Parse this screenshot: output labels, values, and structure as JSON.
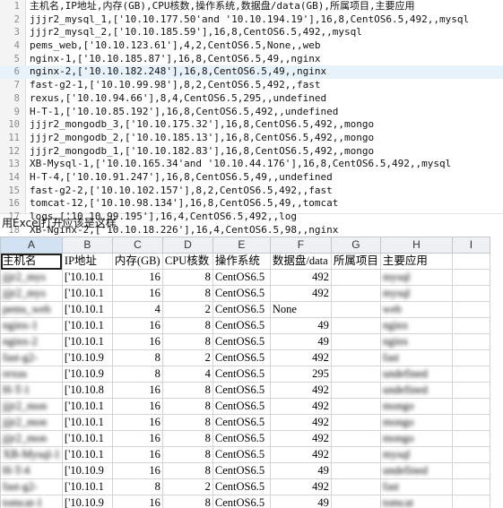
{
  "editor": {
    "lines": [
      {
        "n": "1",
        "text": "主机名,IP地址,内存(GB),CPU核数,操作系统,数据盘/data(GB),所属项目,主要应用"
      },
      {
        "n": "2",
        "text": "jjjr2_mysql_1,['10.10.177.50'and '10.10.194.19'],16,8,CentOS6.5,492,,mysql"
      },
      {
        "n": "3",
        "text": "jjjr2_mysql_2,['10.10.185.59'],16,8,CentOS6.5,492,,mysql"
      },
      {
        "n": "4",
        "text": "pems_web,['10.10.123.61'],4,2,CentOS6.5,None,,web"
      },
      {
        "n": "5",
        "text": "nginx-1,['10.10.185.87'],16,8,CentOS6.5,49,,nginx"
      },
      {
        "n": "6",
        "text": "nginx-2,['10.10.182.248'],16,8,CentOS6.5,49,,nginx"
      },
      {
        "n": "7",
        "text": "fast-g2-1,['10.10.99.98'],8,2,CentOS6.5,492,,fast"
      },
      {
        "n": "8",
        "text": "rexus,['10.10.94.66'],8,4,CentOS6.5,295,,undefined"
      },
      {
        "n": "9",
        "text": "H-T-1,['10.10.85.192'],16,8,CentOS6.5,492,,undefined"
      },
      {
        "n": "10",
        "text": "jjjr2_mongodb_3,['10.10.175.32'],16,8,CentOS6.5,492,,mongo"
      },
      {
        "n": "11",
        "text": "jjjr2_mongodb_2,['10.10.185.13'],16,8,CentOS6.5,492,,mongo"
      },
      {
        "n": "12",
        "text": "jjjr2_mongodb_1,['10.10.182.83'],16,8,CentOS6.5,492,,mongo"
      },
      {
        "n": "13",
        "text": "XB-Mysql-1,['10.10.165.34'and '10.10.44.176'],16,8,CentOS6.5,492,,mysql"
      },
      {
        "n": "14",
        "text": "H-T-4,['10.10.91.247'],16,8,CentOS6.5,49,,undefined"
      },
      {
        "n": "15",
        "text": "fast-g2-2,['10.10.102.157'],8,2,CentOS6.5,492,,fast"
      },
      {
        "n": "16",
        "text": "tomcat-12,['10.10.98.134'],16,8,CentOS6.5,49,,tomcat"
      },
      {
        "n": "17",
        "text": "logs,['10.10.99.195'],16,4,CentOS6.5,492,,log"
      },
      {
        "n": "18",
        "text": "XB-Nginx-2,['10.10.18.226'],16,4,CentOS6.5,98,,nginx"
      }
    ]
  },
  "caption": "用Excel打开应该是这样",
  "sheet": {
    "columns": [
      "A",
      "B",
      "C",
      "D",
      "E",
      "F",
      "G",
      "H",
      "I"
    ],
    "header_row": [
      "主机名",
      "IP地址",
      "内存(GB)",
      "CPU核数",
      "操作系统",
      "数据盘/data",
      "所属项目",
      "主要应用",
      ""
    ],
    "rows": [
      [
        "jjjr2_mys",
        "['10.10.1",
        "16",
        "8",
        "CentOS6.5",
        "492",
        "",
        "mysql",
        ""
      ],
      [
        "jjjr2_mys",
        "['10.10.1",
        "16",
        "8",
        "CentOS6.5",
        "492",
        "",
        "mysql",
        ""
      ],
      [
        "pems_web",
        "['10.10.1",
        "4",
        "2",
        "CentOS6.5",
        "None",
        "",
        "web",
        ""
      ],
      [
        "nginx-1",
        "['10.10.1",
        "16",
        "8",
        "CentOS6.5",
        "49",
        "",
        "nginx",
        ""
      ],
      [
        "nginx-2",
        "['10.10.1",
        "16",
        "8",
        "CentOS6.5",
        "49",
        "",
        "nginx",
        ""
      ],
      [
        "fast-g2-",
        "['10.10.9",
        "8",
        "2",
        "CentOS6.5",
        "492",
        "",
        "fast",
        ""
      ],
      [
        "rexus",
        "['10.10.9",
        "8",
        "4",
        "CentOS6.5",
        "295",
        "",
        "undefined",
        ""
      ],
      [
        "H-T-1",
        "['10.10.8",
        "16",
        "8",
        "CentOS6.5",
        "492",
        "",
        "undefined",
        ""
      ],
      [
        "jjjr2_mon",
        "['10.10.1",
        "16",
        "8",
        "CentOS6.5",
        "492",
        "",
        "mongo",
        ""
      ],
      [
        "jjjr2_mon",
        "['10.10.1",
        "16",
        "8",
        "CentOS6.5",
        "492",
        "",
        "mongo",
        ""
      ],
      [
        "jjjr2_mon",
        "['10.10.1",
        "16",
        "8",
        "CentOS6.5",
        "492",
        "",
        "mongo",
        ""
      ],
      [
        "XB-Mysql-1",
        "['10.10.1",
        "16",
        "8",
        "CentOS6.5",
        "492",
        "",
        "mysql",
        ""
      ],
      [
        "H-T-4",
        "['10.10.9",
        "16",
        "8",
        "CentOS6.5",
        "49",
        "",
        "undefined",
        ""
      ],
      [
        "fast-g2-",
        "['10.10.1",
        "8",
        "2",
        "CentOS6.5",
        "492",
        "",
        "fast",
        ""
      ],
      [
        "tomcat-1",
        "['10.10.9",
        "16",
        "8",
        "CentOS6.5",
        "49",
        "",
        "tomcat",
        ""
      ]
    ],
    "numeric_cols": [
      2,
      3,
      5
    ],
    "blur_cols": [
      0,
      7
    ],
    "selected_header": "A",
    "colors": {
      "header_bg": "#eef0f3",
      "active_header": "#d3e2f3",
      "grid": "#d4d4d4"
    }
  }
}
